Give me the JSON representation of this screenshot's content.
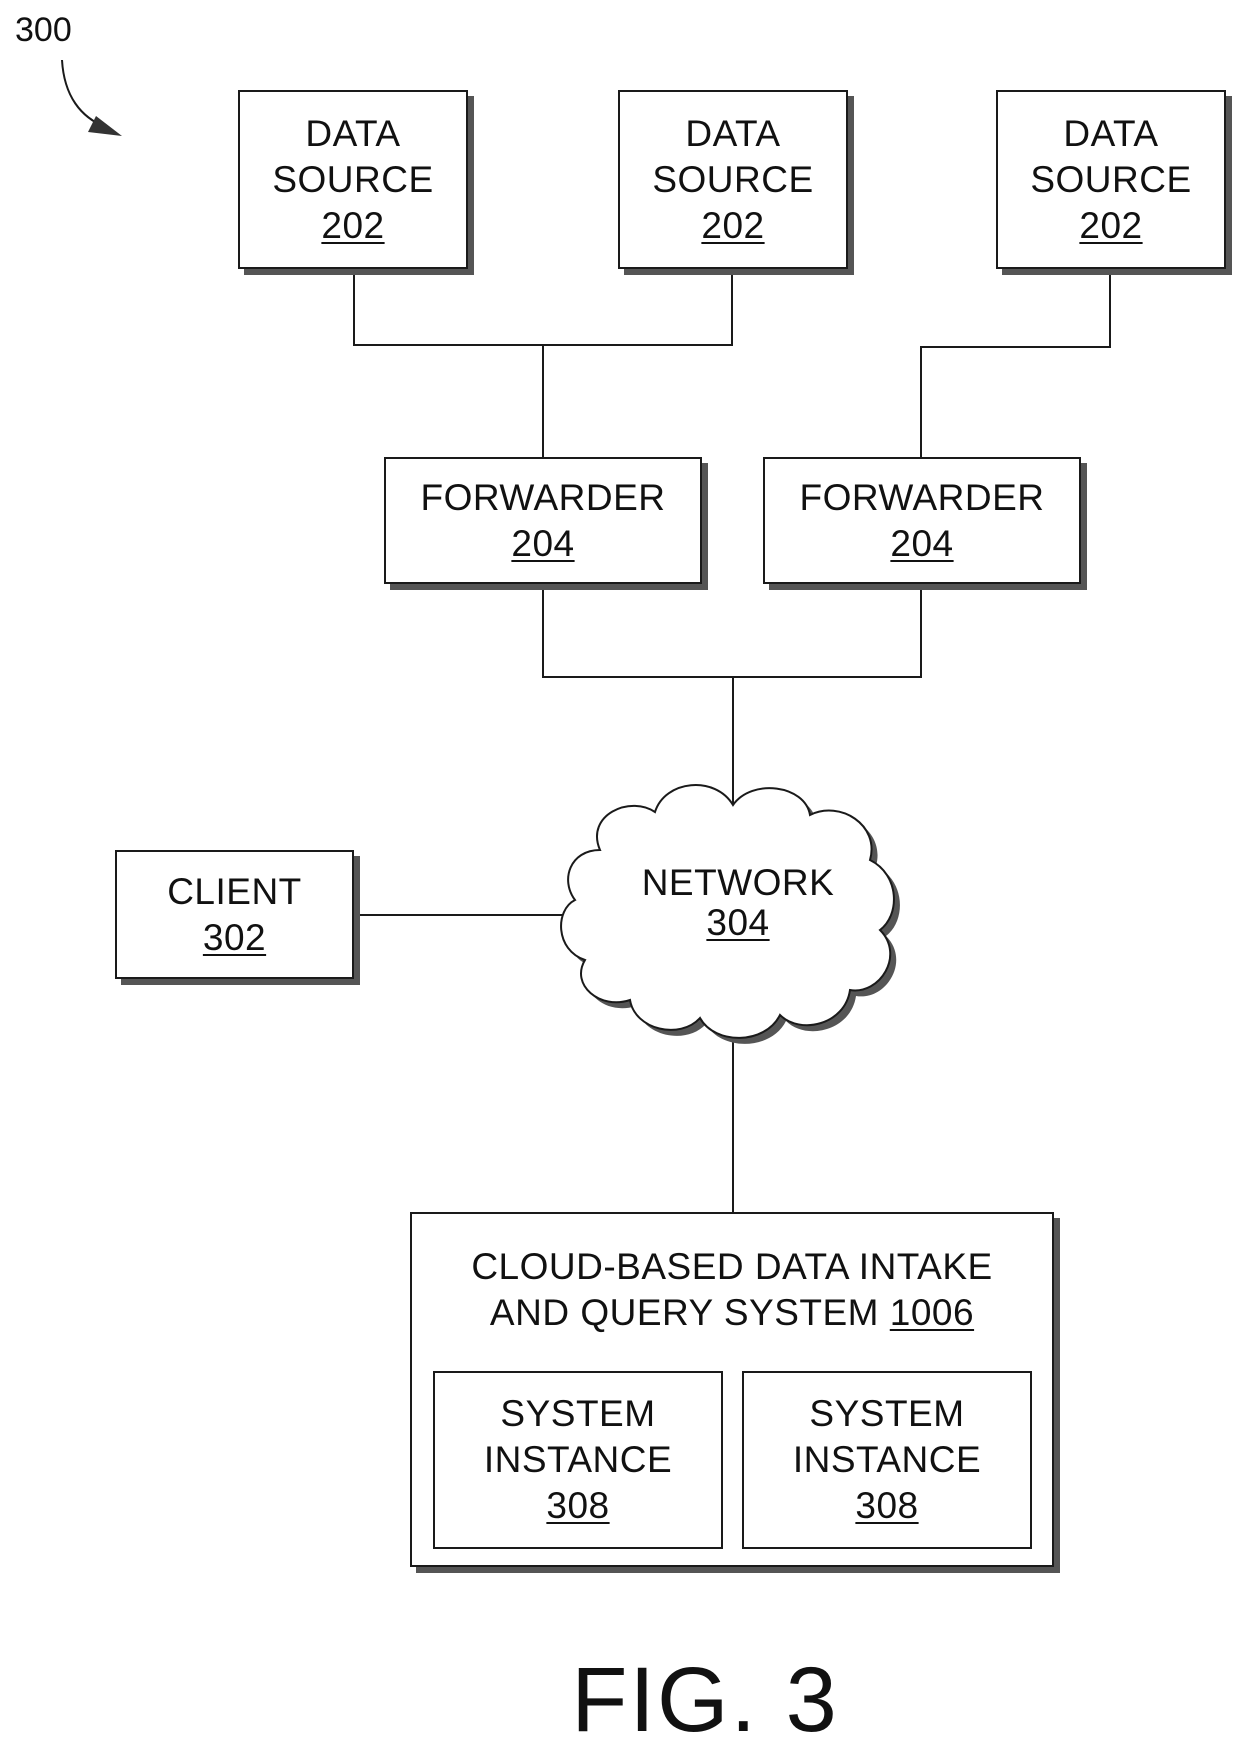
{
  "figure": {
    "reference_number": "300",
    "caption": "FIG. 3"
  },
  "data_sources": [
    {
      "line1": "DATA",
      "line2": "SOURCE",
      "ref": "202"
    },
    {
      "line1": "DATA",
      "line2": "SOURCE",
      "ref": "202"
    },
    {
      "line1": "DATA",
      "line2": "SOURCE",
      "ref": "202"
    }
  ],
  "forwarders": [
    {
      "label": "FORWARDER",
      "ref": "204"
    },
    {
      "label": "FORWARDER",
      "ref": "204"
    }
  ],
  "client": {
    "label": "CLIENT",
    "ref": "302"
  },
  "network": {
    "label": "NETWORK",
    "ref": "304"
  },
  "system": {
    "line1": "CLOUD-BASED DATA INTAKE",
    "line2": "AND QUERY SYSTEM",
    "ref": "1006",
    "instances": [
      {
        "line1": "SYSTEM",
        "line2": "INSTANCE",
        "ref": "308"
      },
      {
        "line1": "SYSTEM",
        "line2": "INSTANCE",
        "ref": "308"
      }
    ]
  }
}
